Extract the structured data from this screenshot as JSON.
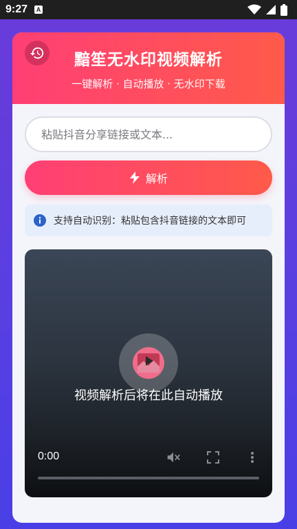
{
  "status_bar": {
    "time": "9:27",
    "badge": "A"
  },
  "header": {
    "title": "黯笙无水印视频解析",
    "subtitle": "一键解析 · 自动播放 · 无水印下载"
  },
  "search": {
    "placeholder": "粘贴抖音分享链接或文本...",
    "value": ""
  },
  "parse_button": {
    "label": "解析"
  },
  "tip": {
    "text": "支持自动识别：粘贴包含抖音链接的文本即可"
  },
  "player": {
    "message": "视频解析后将在此自动播放",
    "time": "0:00",
    "progress": 0
  },
  "colors": {
    "accent_start": "#ff3f75",
    "accent_end": "#ff5a4a",
    "info": "#2a63c9"
  }
}
